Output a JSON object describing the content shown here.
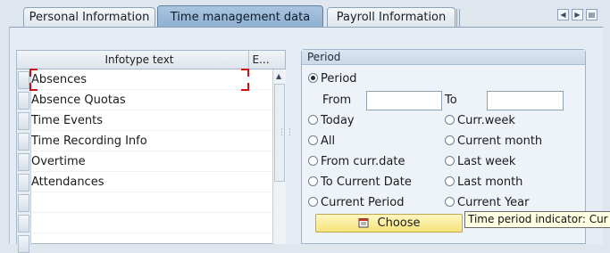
{
  "tabs": [
    {
      "label": "Personal Information",
      "active": false
    },
    {
      "label": "Time management data",
      "active": true
    },
    {
      "label": "Payroll Information",
      "active": false
    }
  ],
  "tab_nav": {
    "left_icon": "arrow-left-icon",
    "right_icon": "arrow-right-icon",
    "list_icon": "tab-list-icon"
  },
  "table": {
    "columns": [
      "Infotype text",
      "E..."
    ],
    "rows": [
      "Absences",
      "Absence Quotas",
      "Time Events",
      "Time Recording Info",
      "Overtime",
      "Attendances"
    ]
  },
  "period": {
    "title": "Period",
    "period_option": "Period",
    "from_label": "From",
    "to_label": "To",
    "from_value": "",
    "to_value": "",
    "selected": "Period",
    "options_left": [
      "Today",
      "All",
      "From curr.date",
      "To Current Date",
      "Current Period"
    ],
    "options_right": [
      "Curr.week",
      "Current month",
      "Last week",
      "Last month",
      "Current Year"
    ],
    "choose_label": "Choose"
  },
  "tooltip": "Time period indicator: Cur",
  "colors": {
    "active_tab": "#8fb0d2",
    "button": "#f6e37a",
    "focus": "#d01010",
    "tooltip_bg": "#ffffe1"
  }
}
